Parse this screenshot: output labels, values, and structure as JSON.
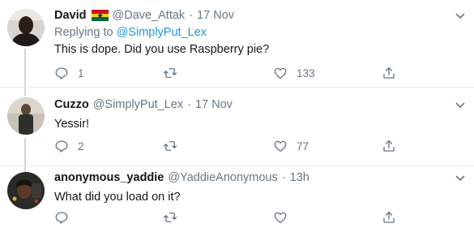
{
  "tweets": [
    {
      "name": "David",
      "handle": "@Dave_Attak",
      "dot": "·",
      "time": "17 Nov",
      "replying_prefix": "Replying to ",
      "replying_to": "@SimplyPut_Lex",
      "text": "This is dope. Did you use Raspberry pie?",
      "replies": "1",
      "retweets": "",
      "likes": "133",
      "flag_colors": [
        "#ce1126",
        "#fcd116",
        "#006b3f"
      ]
    },
    {
      "name": "Cuzzo",
      "handle": "@SimplyPut_Lex",
      "dot": "·",
      "time": "17 Nov",
      "text": "Yessir!",
      "replies": "2",
      "retweets": "",
      "likes": "77"
    },
    {
      "name": "anonymous_yaddie",
      "handle": "@YaddieAnonymous",
      "dot": "·",
      "time": "13h",
      "text": "What did you load on it?",
      "replies": "",
      "retweets": "",
      "likes": ""
    }
  ],
  "colors": {
    "text_primary": "#14171a",
    "text_secondary": "#657786",
    "link": "#1b95e0",
    "separator": "#e6ecf0",
    "thread_line": "#ccd6dd"
  },
  "icons": [
    "reply-icon",
    "retweet-icon",
    "like-icon",
    "share-icon",
    "chevron-down-icon",
    "ghana-flag-icon"
  ]
}
